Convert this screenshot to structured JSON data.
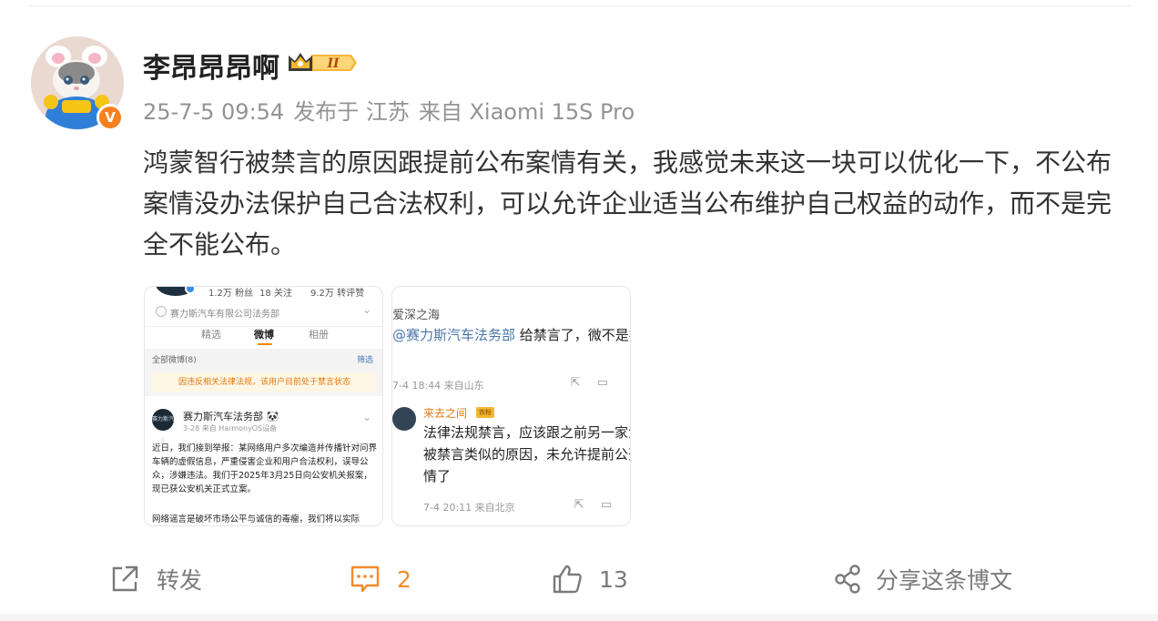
{
  "post": {
    "username": "李昂昂昂啊",
    "vip_level": "II",
    "verified_mark": "V",
    "meta": {
      "time": "25-7-5 09:54",
      "location": "发布于 江苏",
      "source": "来自 Xiaomi 15S Pro"
    },
    "text": "鸿蒙智行被禁言的原因跟提前公布案情有关，我感觉未来这一块可以优化一下，不公布案情没办法保护自己合法权利，可以允许企业适当公布维护自己权益的动作，而不是完全不能公布。"
  },
  "image_left": {
    "stats": [
      "1.2万 粉丝",
      "18 关注",
      "9.2万 转评赞"
    ],
    "company": "赛力斯汽车有限公司法务部",
    "tabs": [
      "精选",
      "微博",
      "相册"
    ],
    "all_posts": "全部微博(8)",
    "filter": "筛选",
    "notice": "因违反相关法律法规，该用户目前处于禁言状态",
    "post_author": "赛力斯汽车法务部",
    "post_author_emoji": "🐼",
    "post_meta": "3-28  来自 HarmonyOS设备",
    "avatar_text": "赛力斯汽车",
    "post_body": "近日，我们接到举报：某网络用户多次编造并传播针对问界车辆的虚假信息，严重侵害企业和用户合法权利，误导公众，涉嫌违法。我们于2025年3月25日向公安机关报案，现已获公安机关正式立案。",
    "post_body2": "网络谣言是破坏市场公平与诚信的毒瘤，我们将以实际"
  },
  "image_right": {
    "user": "爱深之海",
    "mention": "@赛力斯汽车法务部",
    "comment": " 给禁言了，微不是疯了",
    "comment_meta": "7-4 18:44  来自山东",
    "reply_user": "来去之间",
    "reply_badge": "铁粉",
    "reply_text": "法律法规禁言，应该跟之前另一家法务被禁言类似的原因，未允许提前公开案情了",
    "reply_meta": "7-4 20:11  来自北京"
  },
  "actions": {
    "repost_label": "转发",
    "comment_count": "2",
    "like_count": "13",
    "share_label": "分享这条博文"
  },
  "colors": {
    "accent_orange": "#f28a2b",
    "mention_blue": "#4a77a8",
    "meta_gray": "#939393"
  }
}
